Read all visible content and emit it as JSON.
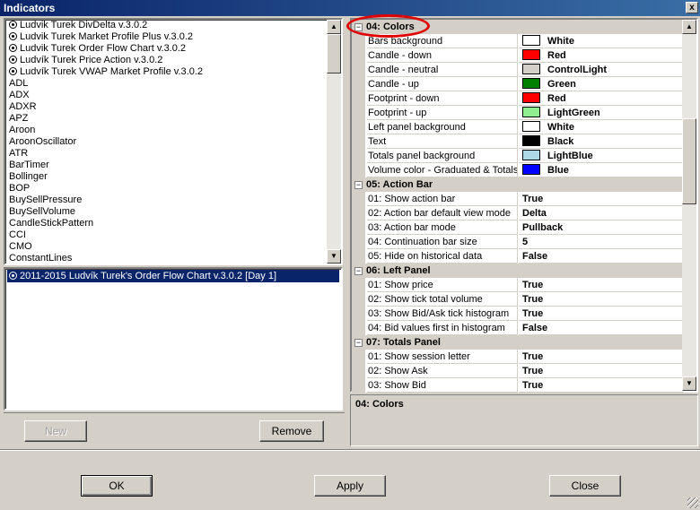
{
  "window": {
    "title": "Indicators",
    "close_glyph": "x"
  },
  "indicator_list": {
    "items": [
      {
        "label": "Ludvik Turek DivDelta v.3.0.2",
        "icon": "stock-indicator-icon"
      },
      {
        "label": "Ludvik Turek Market Profile Plus v.3.0.2",
        "icon": "stock-indicator-icon"
      },
      {
        "label": "Ludvik Turek Order Flow Chart v.3.0.2",
        "icon": "stock-indicator-icon"
      },
      {
        "label": "Ludvík Turek Price Action v.3.0.2",
        "icon": "stock-indicator-icon"
      },
      {
        "label": "Ludvík Turek VWAP Market Profile v.3.0.2",
        "icon": "stock-indicator-icon"
      },
      {
        "label": "ADL"
      },
      {
        "label": "ADX"
      },
      {
        "label": "ADXR"
      },
      {
        "label": "APZ"
      },
      {
        "label": "Aroon"
      },
      {
        "label": "AroonOscillator"
      },
      {
        "label": "ATR"
      },
      {
        "label": "BarTimer"
      },
      {
        "label": "Bollinger"
      },
      {
        "label": "BOP"
      },
      {
        "label": "BuySellPressure"
      },
      {
        "label": "BuySellVolume"
      },
      {
        "label": "CandleStickPattern"
      },
      {
        "label": "CCI"
      },
      {
        "label": "CMO"
      },
      {
        "label": "ConstantLines"
      }
    ]
  },
  "applied_list": {
    "items": [
      {
        "label": "2011-2015 Ludvík Turek's Order Flow Chart v.3.0.2 [Day 1]",
        "selected": true
      }
    ]
  },
  "buttons": {
    "new": "New",
    "remove": "Remove",
    "ok": "OK",
    "apply": "Apply",
    "close": "Close"
  },
  "properties": {
    "categories": [
      {
        "label": "04: Colors",
        "expander": "−",
        "items": [
          {
            "name": "Bars background",
            "value": "White",
            "color": "#ffffff"
          },
          {
            "name": "Candle - down",
            "value": "Red",
            "color": "#ff0000"
          },
          {
            "name": "Candle - neutral",
            "value": "ControlLight",
            "color": "#d4d0c8"
          },
          {
            "name": "Candle - up",
            "value": "Green",
            "color": "#008000"
          },
          {
            "name": "Footprint - down",
            "value": "Red",
            "color": "#ff0000"
          },
          {
            "name": "Footprint - up",
            "value": "LightGreen",
            "color": "#90ee90"
          },
          {
            "name": "Left panel background",
            "value": "White",
            "color": "#ffffff"
          },
          {
            "name": "Text",
            "value": "Black",
            "color": "#000000"
          },
          {
            "name": "Totals panel background",
            "value": "LightBlue",
            "color": "#add8e6"
          },
          {
            "name": "Volume color - Graduated & Totals",
            "value": "Blue",
            "color": "#0000ff"
          }
        ]
      },
      {
        "label": "05: Action Bar",
        "expander": "−",
        "items": [
          {
            "name": "01: Show action bar",
            "value": "True"
          },
          {
            "name": "02: Action bar default view mode",
            "value": "Delta"
          },
          {
            "name": "03: Action bar mode",
            "value": "Pullback"
          },
          {
            "name": "04: Continuation bar size",
            "value": "5"
          },
          {
            "name": "05: Hide on historical data",
            "value": "False"
          }
        ]
      },
      {
        "label": "06: Left Panel",
        "expander": "−",
        "items": [
          {
            "name": "01: Show price",
            "value": "True"
          },
          {
            "name": "02: Show tick total volume",
            "value": "True"
          },
          {
            "name": "03: Show Bid/Ask tick histogram",
            "value": "True"
          },
          {
            "name": "04: Bid values first in histogram",
            "value": "False"
          }
        ]
      },
      {
        "label": "07: Totals Panel",
        "expander": "−",
        "items": [
          {
            "name": "01: Show session letter",
            "value": "True"
          },
          {
            "name": "02: Show Ask",
            "value": "True"
          },
          {
            "name": "03: Show Bid",
            "value": "True"
          }
        ]
      }
    ]
  },
  "description": {
    "title": "04: Colors"
  },
  "scroll_glyphs": {
    "up": "▲",
    "down": "▼"
  }
}
